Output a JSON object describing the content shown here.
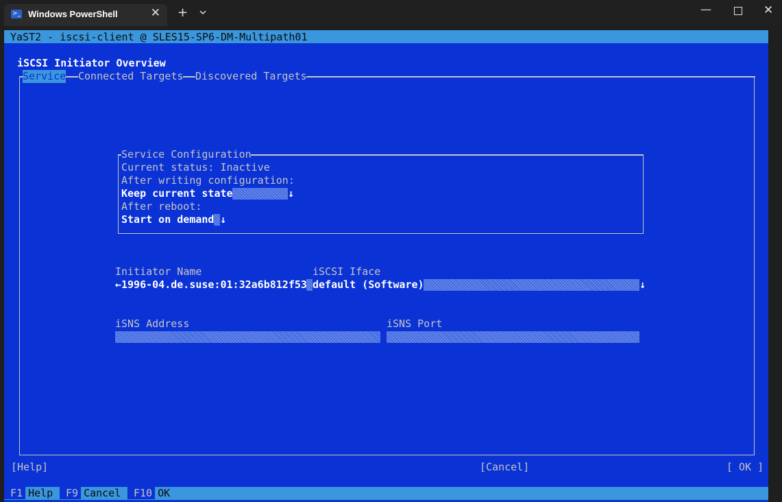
{
  "window": {
    "tab_title": "Windows PowerShell",
    "tab_icon": "powershell-icon",
    "tab_close": "✕",
    "new_tab": "+",
    "minimize": "—",
    "close": "✕"
  },
  "terminal": {
    "title": "YaST2 - iscsi-client @ SLES15-SP6-DM-Multipath01",
    "heading": "iSCSI Initiator Overview",
    "tabs": [
      "Service",
      "Connected Targets",
      "Discovered Targets"
    ],
    "active_tab": "Service",
    "service_config": {
      "label": "Service Configuration",
      "current_status": "Current status: Inactive",
      "after_writing_label": "After writing configuration:",
      "after_writing_value": "Keep current state",
      "after_reboot_label": "After reboot:",
      "after_reboot_value": "Start on demand"
    },
    "initiator_name_label": "Initiator Name",
    "initiator_name_value": "1996-04.de.suse:01:32a6b812f53",
    "iscsi_iface_label": "iSCSI Iface",
    "iscsi_iface_value": "default (Software)",
    "isns_address_label": "iSNS Address",
    "isns_port_label": "iSNS Port",
    "buttons": {
      "help": "[Help]",
      "cancel": "[Cancel]",
      "ok": "[ OK ]"
    },
    "fkeys": [
      {
        "key": "F1",
        "label": "Help"
      },
      {
        "key": "F9",
        "label": "Cancel"
      },
      {
        "key": "F10",
        "label": "OK"
      }
    ],
    "colors": {
      "background": "#0a32d4",
      "highlight": "#3a96dd",
      "text": "#c6c6c6"
    }
  }
}
